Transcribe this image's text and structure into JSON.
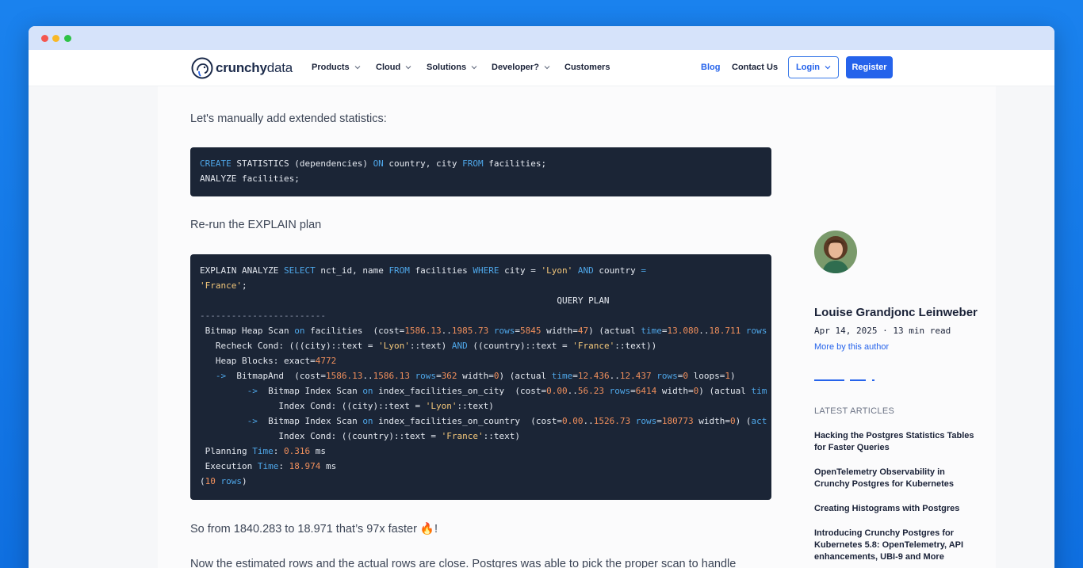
{
  "nav": {
    "logo_bold": "crunchy",
    "logo_light": "data",
    "products": "Products",
    "cloud": "Cloud",
    "solutions": "Solutions",
    "developer": "Developer?",
    "customers": "Customers",
    "blog": "Blog",
    "contact": "Contact Us",
    "login": "Login",
    "register": "Register"
  },
  "article": {
    "p1": "Let's manually add extended statistics:",
    "p2": "Re-run the EXPLAIN plan",
    "p3": "So from 1840.283 to 18.971 that’s 97x faster 🔥!",
    "p4": "Now the estimated rows and the actual rows are close. Postgres was able to pick the proper scan to handle"
  },
  "code1": [
    "CREATE STATISTICS (dependencies) ON country, city FROM facilities;",
    "ANALYZE facilities;"
  ],
  "code2": [
    "EXPLAIN ANALYZE SELECT nct_id, name FROM facilities WHERE city = 'Lyon' AND country =",
    "'France';",
    "                                                                    QUERY PLAN",
    "------------------------",
    " Bitmap Heap Scan on facilities  (cost=1586.13..1985.73 rows=5845 width=47) (actual time=13.080..18.711 rows",
    "   Recheck Cond: (((city)::text = 'Lyon'::text) AND ((country)::text = 'France'::text))",
    "   Heap Blocks: exact=4772",
    "   ->  BitmapAnd  (cost=1586.13..1586.13 rows=362 width=0) (actual time=12.436..12.437 rows=0 loops=1)",
    "         ->  Bitmap Index Scan on index_facilities_on_city  (cost=0.00..56.23 rows=6414 width=0) (actual tim",
    "               Index Cond: ((city)::text = 'Lyon'::text)",
    "         ->  Bitmap Index Scan on index_facilities_on_country  (cost=0.00..1526.73 rows=180773 width=0) (act",
    "               Index Cond: ((country)::text = 'France'::text)",
    " Planning Time: 0.316 ms",
    " Execution Time: 18.974 ms",
    "(10 rows)"
  ],
  "sidebar": {
    "author": "Louise Grandjonc Leinweber",
    "meta": "Apr 14, 2025 · 13 min read",
    "more": "More by this author",
    "latest_heading": "LATEST ARTICLES",
    "latest": [
      "Hacking the Postgres Statistics Tables for Faster Queries",
      "OpenTelemetry Observability in Crunchy Postgres for Kubernetes",
      "Creating Histograms with Postgres",
      "Introducing Crunchy Postgres for Kubernetes 5.8: OpenTelemetry, API enhancements, UBI-9 and More"
    ]
  },
  "colors": {
    "accent": "#2563eb",
    "code_bg": "#1b2536",
    "keyword": "#4ea6e8",
    "string": "#f3c77a",
    "number": "#f08f5c"
  }
}
